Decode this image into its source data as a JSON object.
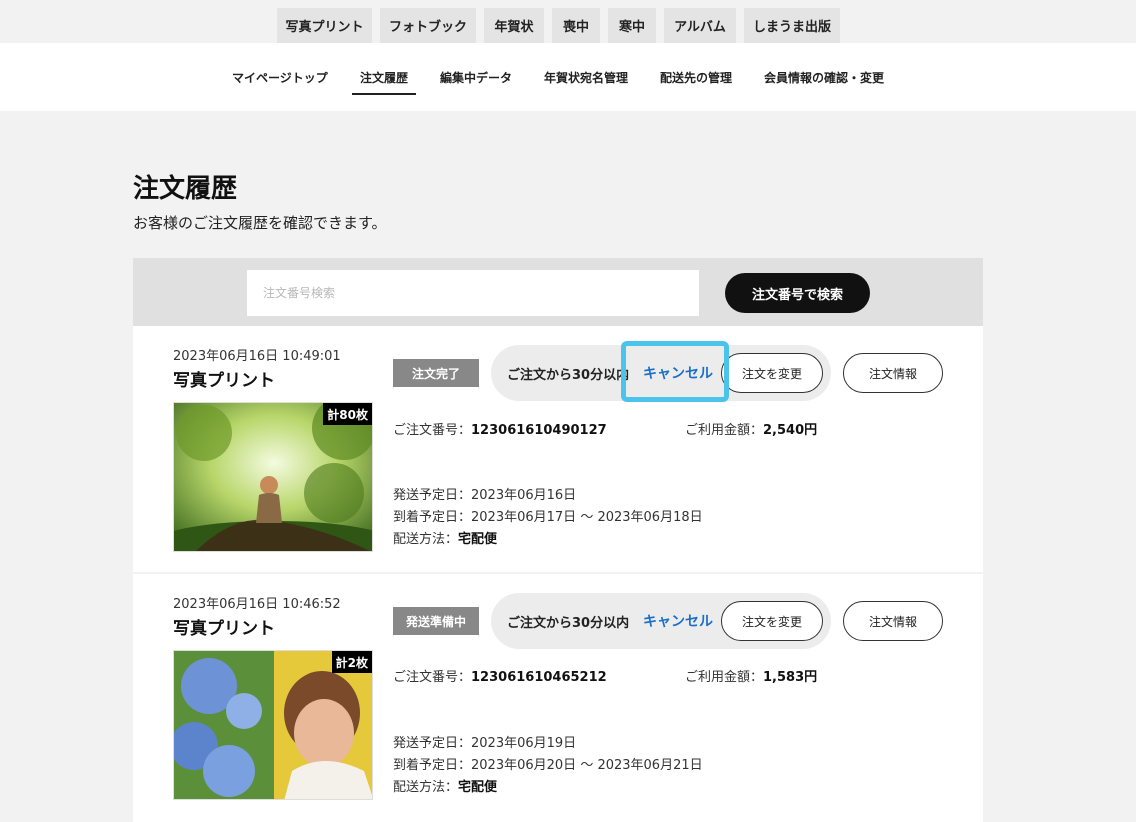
{
  "category_tabs": [
    "写真プリント",
    "フォトブック",
    "年賀状",
    "喪中",
    "寒中",
    "アルバム",
    "しまうま出版"
  ],
  "mypage_nav": [
    "マイページトップ",
    "注文履歴",
    "編集中データ",
    "年賀状宛名管理",
    "配送先の管理",
    "会員情報の確認・変更"
  ],
  "active_nav": "注文履歴",
  "page": {
    "title": "注文履歴",
    "subtitle": "お客様のご注文履歴を確認できます。"
  },
  "search": {
    "placeholder": "注文番号検索",
    "value": "",
    "button_label": "注文番号で検索"
  },
  "orders": [
    {
      "date": "2023年06月16日 10:49:01",
      "product": "写真プリント",
      "count_badge": "計80枚",
      "status": "注文完了",
      "within_text": "ご注文から30分以内",
      "cancel_label": "キャンセル",
      "change_label": "注文を変更",
      "info_label": "注文情報",
      "order_no_label": "ご注文番号：",
      "order_no": "123061610490127",
      "amount_label": "ご利用金額：",
      "amount": "2,540円",
      "ship_label": "発送予定日：",
      "ship_date": "2023年06月16日",
      "arrive_label": "到着予定日：",
      "arrive_date": "2023年06月17日 〜 2023年06月18日",
      "method_label": "配送方法：",
      "method": "宅配便"
    },
    {
      "date": "2023年06月16日 10:46:52",
      "product": "写真プリント",
      "count_badge": "計2枚",
      "status": "発送準備中",
      "within_text": "ご注文から30分以内",
      "cancel_label": "キャンセル",
      "change_label": "注文を変更",
      "info_label": "注文情報",
      "order_no_label": "ご注文番号：",
      "order_no": "123061610465212",
      "amount_label": "ご利用金額：",
      "amount": "1,583円",
      "ship_label": "発送予定日：",
      "ship_date": "2023年06月19日",
      "arrive_label": "到着予定日：",
      "arrive_date": "2023年06月20日 〜 2023年06月21日",
      "method_label": "配送方法：",
      "method": "宅配便"
    }
  ],
  "colors": {
    "status_badge": "#888888",
    "cancel_link": "#1a6fc9",
    "highlight_box": "#4cc3ea",
    "search_button": "#111111"
  }
}
